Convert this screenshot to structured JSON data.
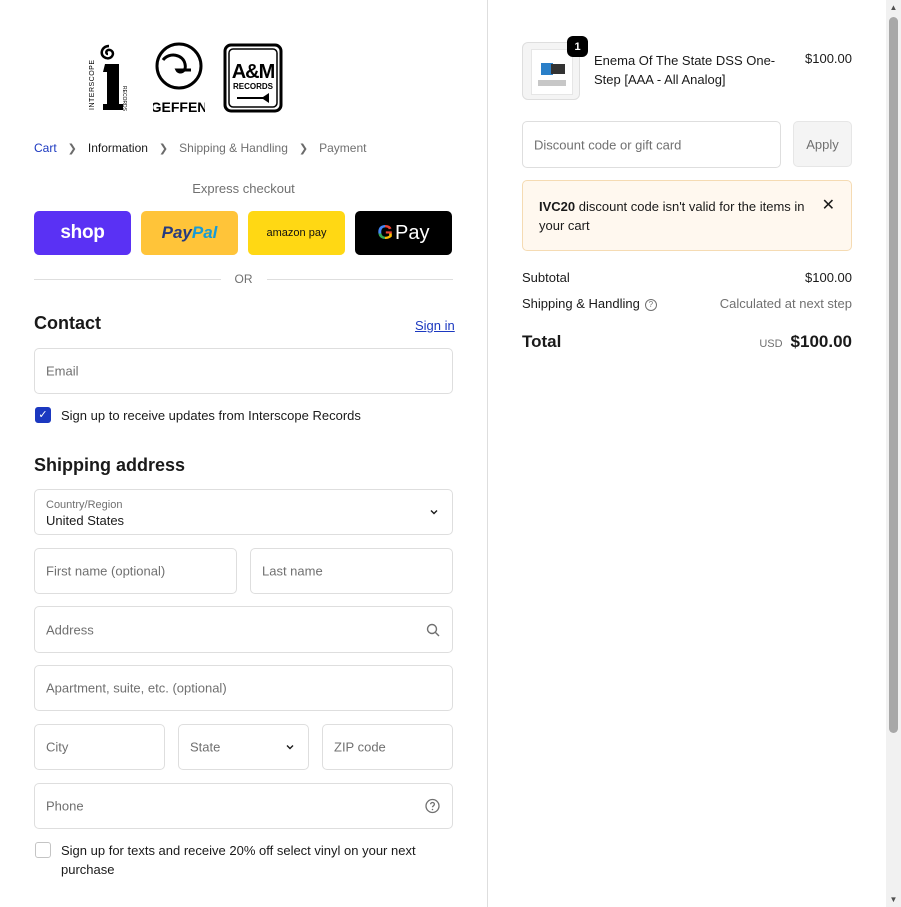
{
  "brand": {
    "logos": [
      "INTERSCOPE",
      "RECORDS",
      "GEFFEN",
      "A&M",
      "RECORDS"
    ]
  },
  "breadcrumb": {
    "items": [
      "Cart",
      "Information",
      "Shipping & Handling",
      "Payment"
    ]
  },
  "express": {
    "title": "Express checkout",
    "buttons": {
      "shop": "shop",
      "paypal_a": "Pay",
      "paypal_b": "Pal",
      "amazon": "amazon pay",
      "gpay_g": "G",
      "gpay_text": "Pay"
    },
    "or": "OR"
  },
  "contact": {
    "heading": "Contact",
    "signin": "Sign in",
    "email_placeholder": "Email",
    "newsletter_label": "Sign up to receive updates from Interscope Records",
    "newsletter_checked": true
  },
  "shipping": {
    "heading": "Shipping address",
    "country_label": "Country/Region",
    "country_value": "United States",
    "first_name_placeholder": "First name (optional)",
    "last_name_placeholder": "Last name",
    "address_placeholder": "Address",
    "apartment_placeholder": "Apartment, suite, etc. (optional)",
    "city_placeholder": "City",
    "state_placeholder": "State",
    "zip_placeholder": "ZIP code",
    "phone_placeholder": "Phone",
    "sms_label": "Sign up for texts and receive 20% off select vinyl on your next purchase",
    "sms_checked": false
  },
  "order": {
    "item": {
      "quantity": "1",
      "name": "Enema Of The State DSS One-Step [AAA - All Analog]",
      "price": "$100.00"
    },
    "discount_placeholder": "Discount code or gift card",
    "apply_label": "Apply",
    "alert": {
      "code": "IVC20",
      "message": " discount code isn't valid for the items in your cart"
    },
    "subtotal_label": "Subtotal",
    "subtotal_value": "$100.00",
    "shipping_label": "Shipping & Handling",
    "shipping_value": "Calculated at next step",
    "total_label": "Total",
    "currency": "USD",
    "total_value": "$100.00"
  },
  "colors": {
    "link": "#1b38c0",
    "shop": "#5a31f4",
    "paypal": "#ffc439",
    "amazon": "#ffd814",
    "gpay": "#000000",
    "alert_bg": "#fff8ef"
  }
}
